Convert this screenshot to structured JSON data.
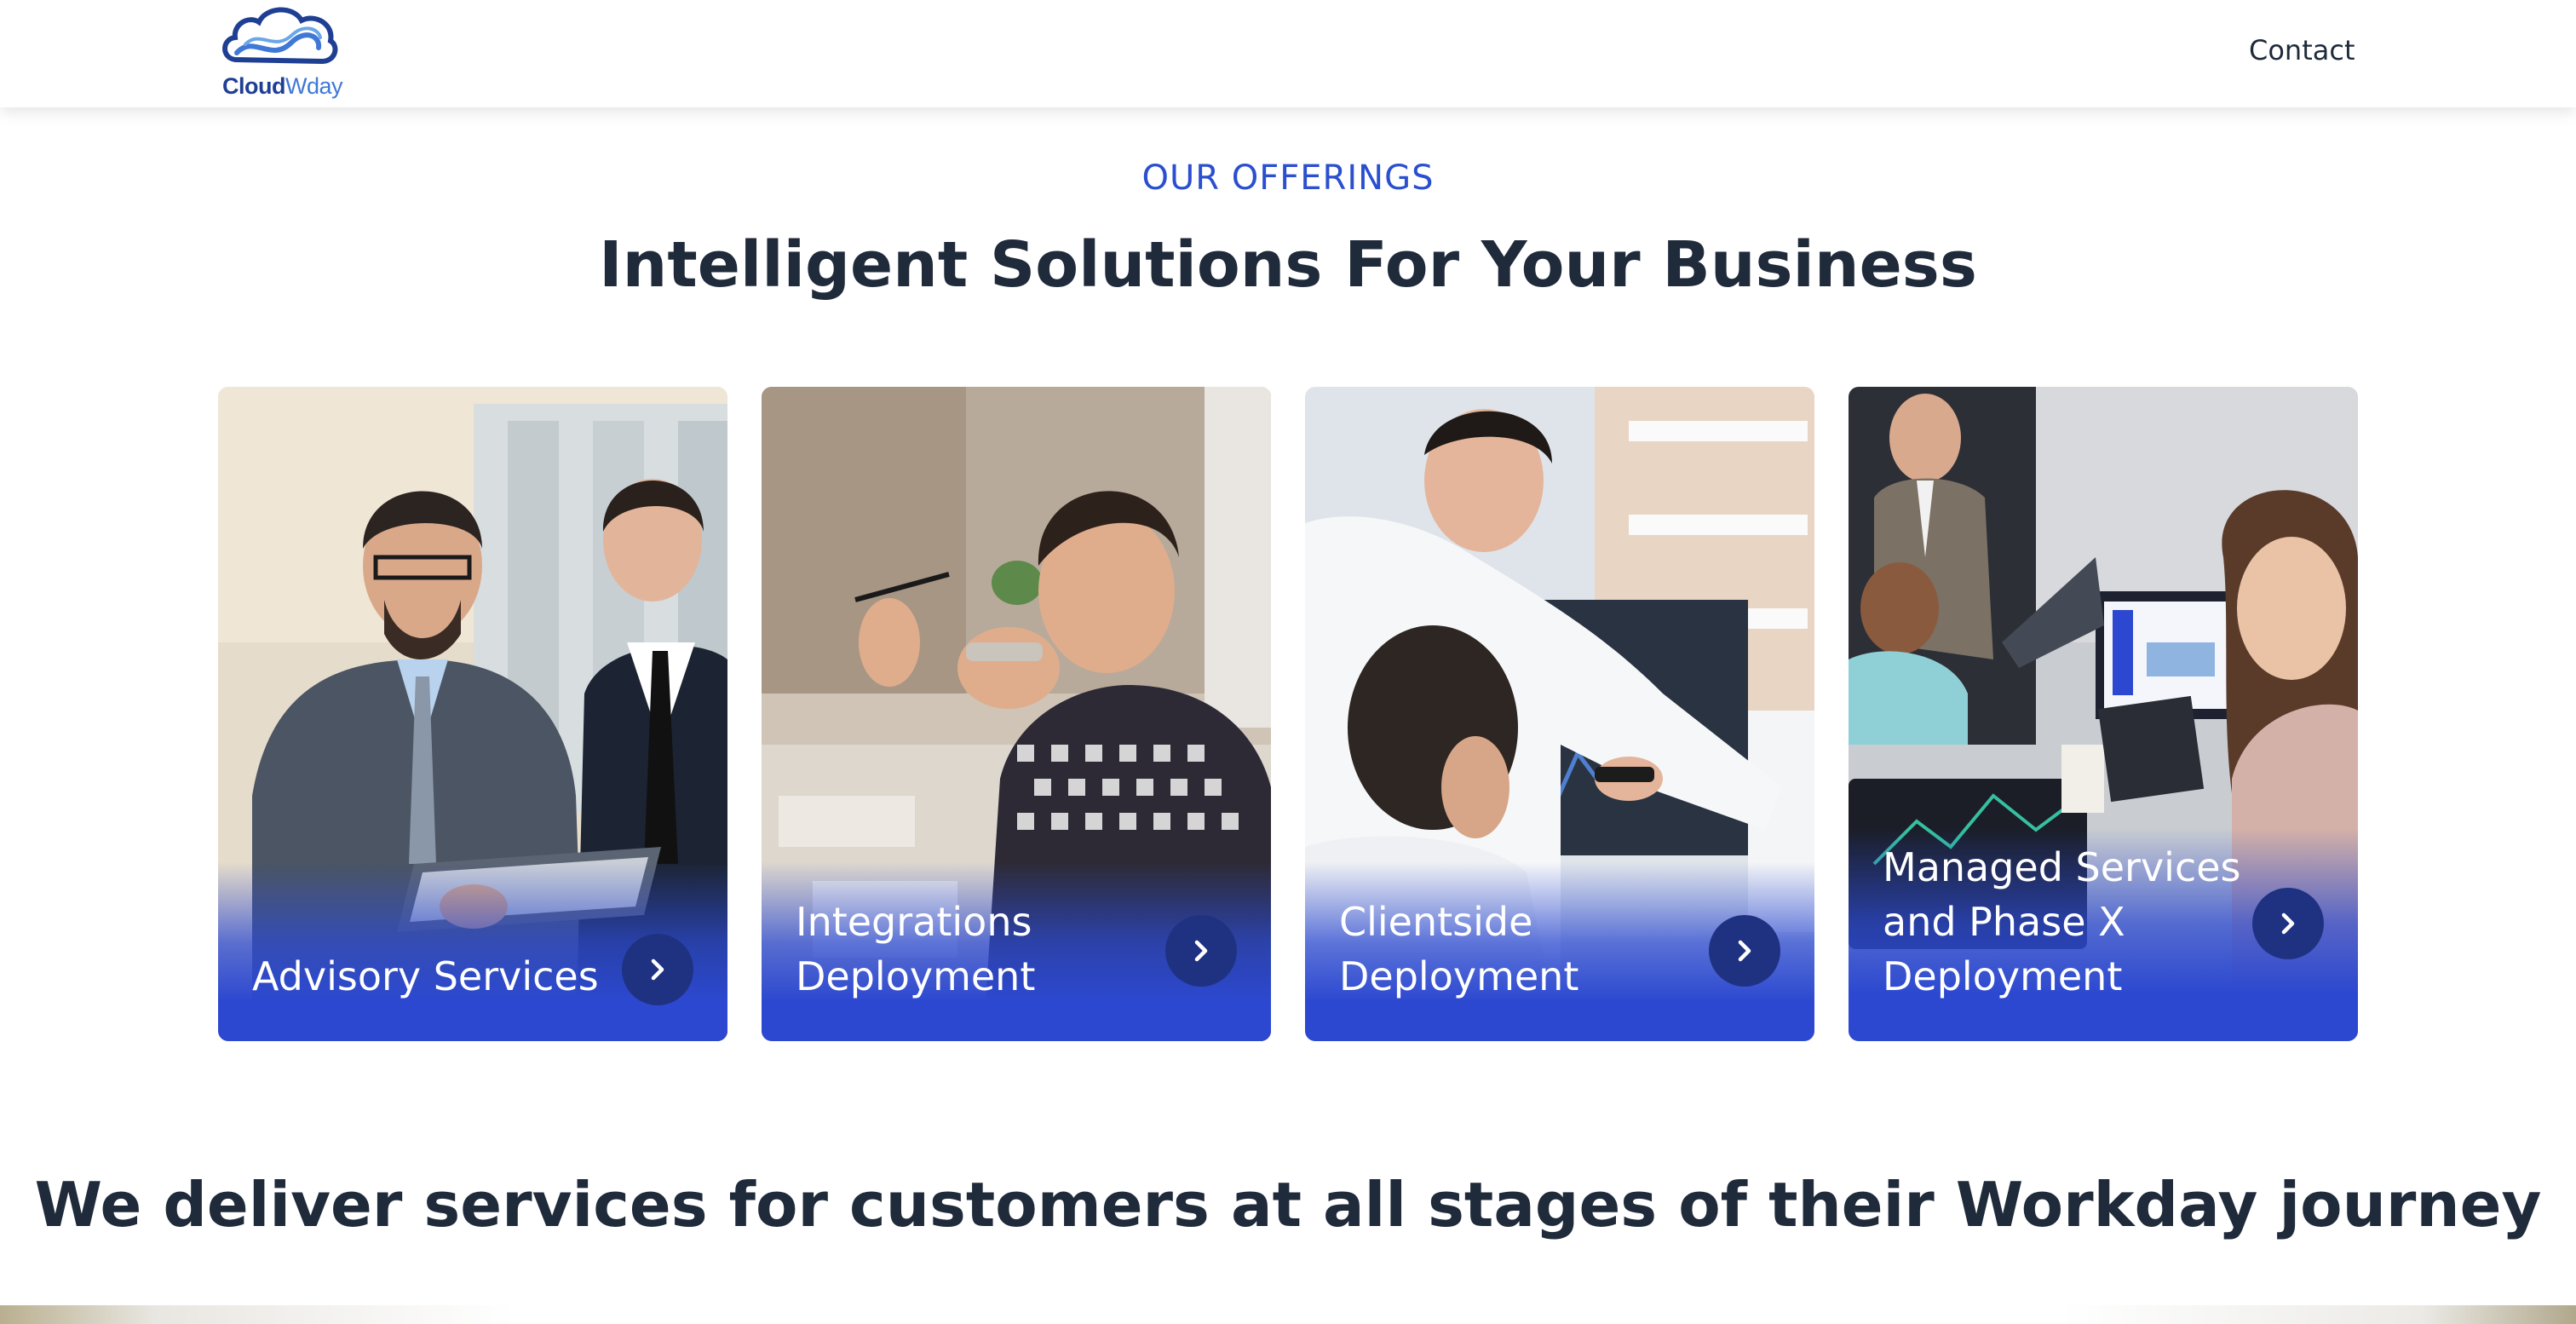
{
  "header": {
    "logo": {
      "part1": "Cloud",
      "part2": "Wday"
    },
    "nav": {
      "contact": "Contact"
    }
  },
  "section": {
    "eyebrow": "OUR OFFERINGS",
    "headline": "Intelligent Solutions For Your Business"
  },
  "cards": [
    {
      "title": "Advisory Services"
    },
    {
      "title": "Integrations Deployment"
    },
    {
      "title": "Clientside Deployment"
    },
    {
      "title": "Managed Services and Phase X Deployment"
    }
  ],
  "tagline": "We deliver services for customers at all stages of their Workday journey",
  "colors": {
    "accent": "#2a4fcf",
    "card_overlay": "#2c48d0",
    "arrow_button": "#1f3282",
    "text_dark": "#1f2a3a"
  }
}
